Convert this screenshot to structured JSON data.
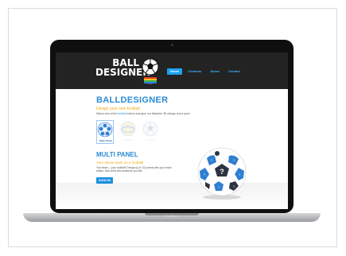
{
  "device": {
    "brand": "MacBook"
  },
  "site": {
    "logo": {
      "line1": "BALL",
      "line2": "DESIGNER"
    },
    "nav": [
      {
        "label": "Home",
        "active": true
      },
      {
        "label": "Contacts",
        "active": false
      },
      {
        "label": "About",
        "active": false
      },
      {
        "label": "Contact",
        "active": false
      }
    ],
    "title": "BALLDESIGNER",
    "tagline": "Design your own football",
    "intro_before": "Select one of the ",
    "intro_link": "football",
    "intro_after": " below and give our Machine 3D design tool a spin!",
    "ball_choices": [
      {
        "label": "Multi Panel",
        "selected": true
      },
      {
        "label": "Premium",
        "selected": false
      },
      {
        "label": "Stadium",
        "selected": false
      }
    ],
    "section": {
      "title": "MULTI PANEL",
      "subtitle": "Your whole team on a football",
      "description": "Your team – your football! Design up to 32 panels with your team mates, club crest and whatever you like.",
      "cta": "SIGN IN"
    },
    "colors": {
      "accent": "#2a8bd6",
      "highlight": "#f0a818",
      "header_bg": "#232323",
      "button": "#1e8fe0"
    },
    "icons": [
      "football-icon",
      "rainbow-stripes-icon",
      "multi-panel-ball-icon",
      "premium-ball-icon",
      "stadium-ball-icon",
      "custom-football-illustration"
    ]
  }
}
